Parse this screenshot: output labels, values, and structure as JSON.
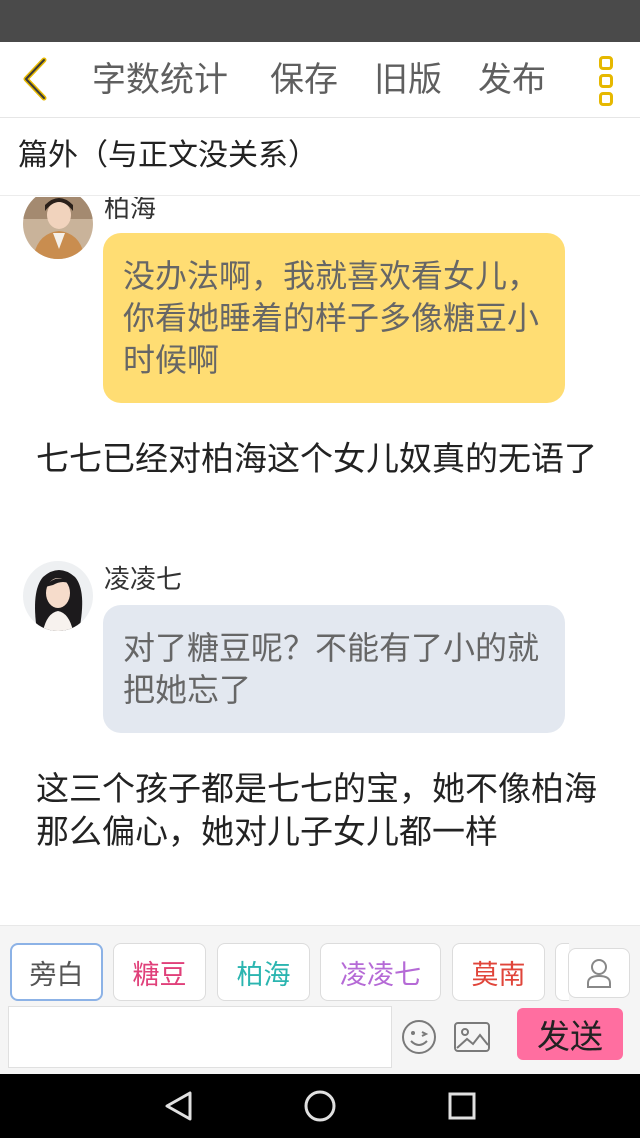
{
  "toolbar": {
    "back_icon": "chevron-left-icon",
    "word_count": "字数统计",
    "save": "保存",
    "old_version": "旧版",
    "publish": "发布",
    "more_icon": "more-vertical-icon",
    "accent_color": "#e6b800"
  },
  "chapter": {
    "title": "篇外（与正文没关系）"
  },
  "messages": [
    {
      "type": "dialogue",
      "speaker": "柏海",
      "text": "没办法啊，我就喜欢看女儿，你看她睡着的样子多像糖豆小时候啊",
      "bubble_color": "#ffdd73"
    },
    {
      "type": "narration",
      "text": "七七已经对柏海这个女儿奴真的无语了"
    },
    {
      "type": "dialogue",
      "speaker": "凌凌七",
      "text": "对了糖豆呢？不能有了小的就把她忘了",
      "bubble_color": "#e3e8f0"
    },
    {
      "type": "narration",
      "text": "这三个孩子都是七七的宝，她不像柏海那么偏心，她对儿子女儿都一样"
    }
  ],
  "characters": [
    {
      "label": "旁白",
      "color": "#555555",
      "selected": true
    },
    {
      "label": "糖豆",
      "color": "#e0407a"
    },
    {
      "label": "柏海",
      "color": "#2bb5b0"
    },
    {
      "label": "凌凌七",
      "color": "#b56ad6"
    },
    {
      "label": "莫南",
      "color": "#e0453a"
    }
  ],
  "composer": {
    "input_value": "",
    "emoji_icon": "smiley-icon",
    "image_icon": "image-icon",
    "profile_icon": "person-icon",
    "send_label": "发送",
    "send_color": "#ff6ea0"
  },
  "system_nav": {
    "back_icon": "triangle-back-icon",
    "home_icon": "circle-home-icon",
    "recents_icon": "square-recents-icon"
  }
}
